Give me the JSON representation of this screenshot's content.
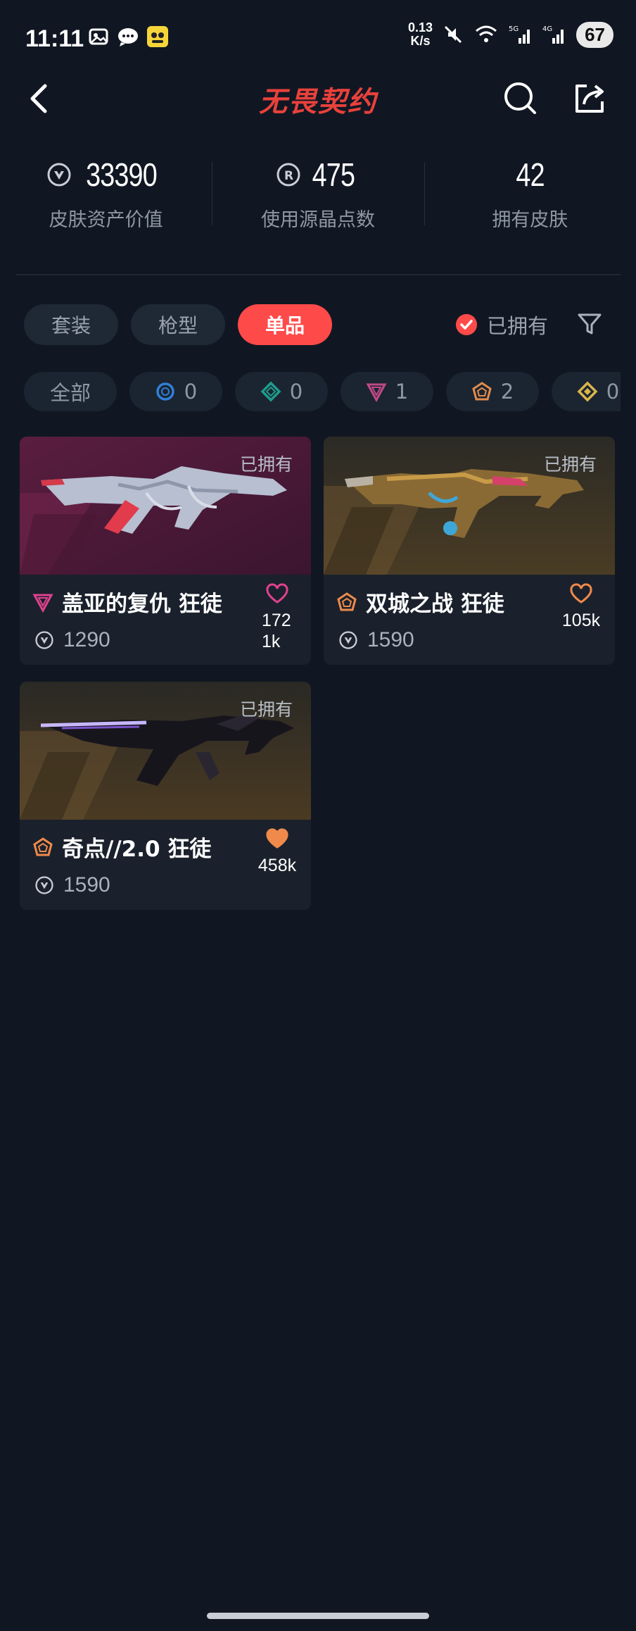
{
  "status_bar": {
    "time": "11:11",
    "net_speed_value": "0.13",
    "net_speed_unit": "K/s",
    "battery": "67",
    "icons": [
      "gallery-icon",
      "chat-icon",
      "app-icon",
      "mute-icon",
      "wifi-icon",
      "signal-5g-icon",
      "signal-4g-icon"
    ]
  },
  "header": {
    "logo_text": "无畏契约",
    "brand_color": "#e8413c"
  },
  "stats": [
    {
      "icon": "valorant-points-icon",
      "value": "33390",
      "label": "皮肤资产价值"
    },
    {
      "icon": "radianite-icon",
      "value": "475",
      "label": "使用源晶点数"
    },
    {
      "icon": "",
      "value": "42",
      "label": "拥有皮肤"
    }
  ],
  "tabs": [
    {
      "label": "套装",
      "active": false
    },
    {
      "label": "枪型",
      "active": false
    },
    {
      "label": "单品",
      "active": true
    }
  ],
  "owned_filter": {
    "label": "已拥有",
    "checked": true
  },
  "rarity_chips": [
    {
      "label": "全部",
      "icon": "",
      "count": ""
    },
    {
      "label": "",
      "icon": "select-tier-icon",
      "count": "0",
      "color": "#2f7fd6"
    },
    {
      "label": "",
      "icon": "deluxe-tier-icon",
      "count": "0",
      "color": "#1e9c8c"
    },
    {
      "label": "",
      "icon": "premium-tier-icon",
      "count": "1",
      "color": "#c04a86"
    },
    {
      "label": "",
      "icon": "exclusive-tier-icon",
      "count": "2",
      "color": "#e28b4b"
    },
    {
      "label": "",
      "icon": "ultra-tier-icon",
      "count": "0",
      "color": "#d9b54a"
    }
  ],
  "items": [
    {
      "name": "盖亚的复仇 狂徒",
      "price": "1290",
      "likes": "1721k",
      "owned_label": "已拥有",
      "tier_color": "#e0418f",
      "liked": false,
      "heart_color": "#e0418f"
    },
    {
      "name": "双城之战 狂徒",
      "price": "1590",
      "likes": "105k",
      "owned_label": "已拥有",
      "tier_color": "#f08a4b",
      "liked": false,
      "heart_color": "#f08a4b"
    },
    {
      "name": "奇点//2.0 狂徒",
      "price": "1590",
      "likes": "458k",
      "owned_label": "已拥有",
      "tier_color": "#f08a4b",
      "liked": true,
      "heart_color": "#f08a4b"
    }
  ]
}
